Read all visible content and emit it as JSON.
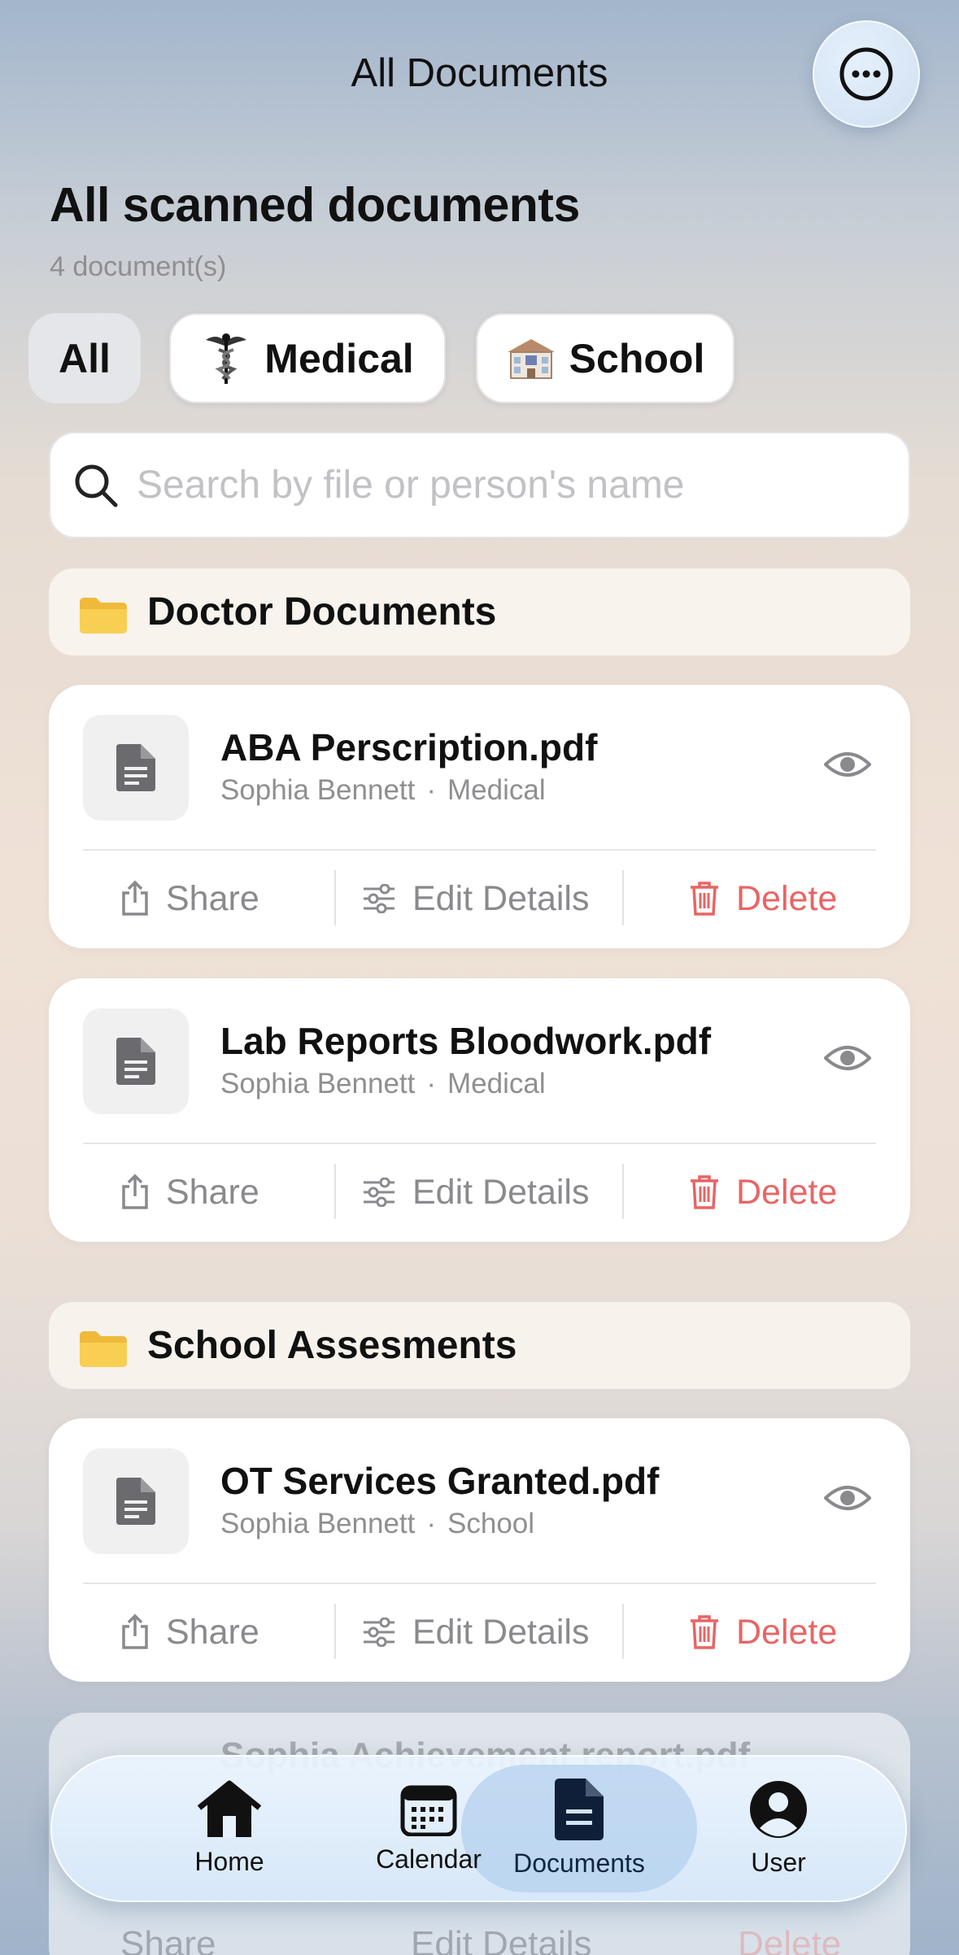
{
  "header": {
    "title": "All Documents",
    "more_icon": "ellipsis-circle-icon"
  },
  "main": {
    "heading": "All scanned documents",
    "count": "4 document(s)"
  },
  "filters": [
    {
      "label": "All",
      "icon": "",
      "active": true
    },
    {
      "label": "Medical",
      "icon": "caduceus-icon",
      "active": false
    },
    {
      "label": "School",
      "icon": "school-building-icon",
      "active": false
    }
  ],
  "search": {
    "placeholder": "Search by file or person's name"
  },
  "folders": [
    {
      "name": "Doctor Documents",
      "documents": [
        {
          "name": "ABA Perscription.pdf",
          "person": "Sophia Bennett",
          "category": "Medical"
        },
        {
          "name": "Lab Reports Bloodwork.pdf",
          "person": "Sophia Bennett",
          "category": "Medical"
        }
      ]
    },
    {
      "name": "School Assesments",
      "documents": [
        {
          "name": "OT Services Granted.pdf",
          "person": "Sophia Bennett",
          "category": "School"
        },
        {
          "name": "Sophia Achievement report.pdf",
          "person": "",
          "category": ""
        }
      ]
    }
  ],
  "actions": {
    "share": "Share",
    "edit": "Edit Details",
    "delete": "Delete",
    "separator": "·"
  },
  "tabbar": [
    {
      "label": "Home",
      "icon": "house-icon"
    },
    {
      "label": "Calendar",
      "icon": "calendar-icon"
    },
    {
      "label": "Documents",
      "icon": "document-icon",
      "active": true
    },
    {
      "label": "User",
      "icon": "person-circle-icon"
    }
  ],
  "colors": {
    "delete": "#e96464",
    "folder": "#f6c945",
    "accent_tab": "#b4d0ee"
  }
}
